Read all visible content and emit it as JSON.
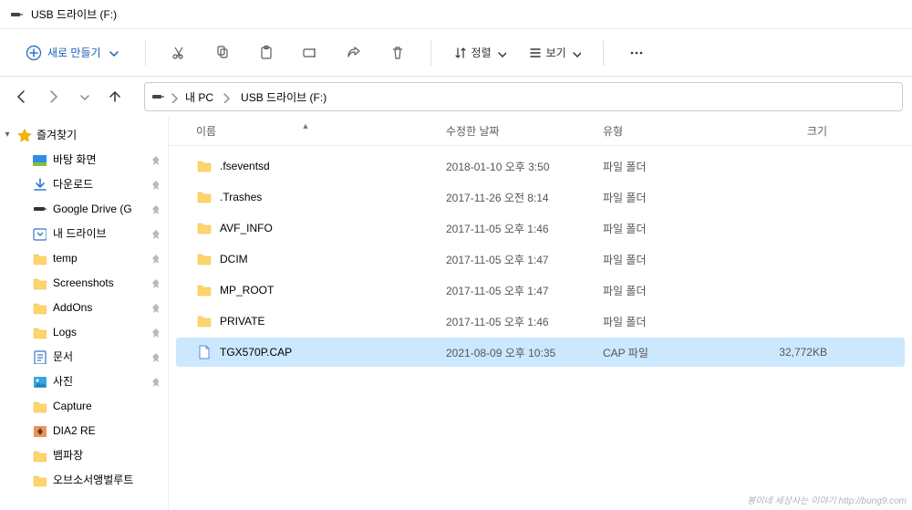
{
  "window": {
    "title": "USB 드라이브 (F:)"
  },
  "toolbar": {
    "new_label": "새로 만들기",
    "sort_label": "정렬",
    "view_label": "보기"
  },
  "breadcrumb": [
    {
      "label": "내 PC"
    },
    {
      "label": "USB 드라이브 (F:)"
    }
  ],
  "sidebar": {
    "favorites_label": "즐겨찾기",
    "items": [
      {
        "label": "바탕 화면",
        "icon": "desktop",
        "pinned": true
      },
      {
        "label": "다운로드",
        "icon": "download",
        "pinned": true
      },
      {
        "label": "Google Drive (G",
        "icon": "gdrive",
        "pinned": true
      },
      {
        "label": "내 드라이브",
        "icon": "mydrive",
        "pinned": true
      },
      {
        "label": "temp",
        "icon": "folder",
        "pinned": true
      },
      {
        "label": "Screenshots",
        "icon": "folder",
        "pinned": true
      },
      {
        "label": "AddOns",
        "icon": "folder",
        "pinned": true
      },
      {
        "label": "Logs",
        "icon": "folder",
        "pinned": true
      },
      {
        "label": "문서",
        "icon": "documents",
        "pinned": true
      },
      {
        "label": "사진",
        "icon": "pictures",
        "pinned": true
      },
      {
        "label": "Capture",
        "icon": "folder"
      },
      {
        "label": "DIA2 RE",
        "icon": "dia2"
      },
      {
        "label": "뱀파장",
        "icon": "folder"
      },
      {
        "label": "오브소서앵벌루트",
        "icon": "folder"
      }
    ]
  },
  "columns": {
    "name": "이름",
    "modified": "수정한 날짜",
    "type": "유형",
    "size": "크기"
  },
  "files": [
    {
      "name": ".fseventsd",
      "modified": "2018-01-10 오후 3:50",
      "type": "파일 폴더",
      "size": "",
      "kind": "folder"
    },
    {
      "name": ".Trashes",
      "modified": "2017-11-26 오전 8:14",
      "type": "파일 폴더",
      "size": "",
      "kind": "folder"
    },
    {
      "name": "AVF_INFO",
      "modified": "2017-11-05 오후 1:46",
      "type": "파일 폴더",
      "size": "",
      "kind": "folder"
    },
    {
      "name": "DCIM",
      "modified": "2017-11-05 오후 1:47",
      "type": "파일 폴더",
      "size": "",
      "kind": "folder"
    },
    {
      "name": "MP_ROOT",
      "modified": "2017-11-05 오후 1:47",
      "type": "파일 폴더",
      "size": "",
      "kind": "folder"
    },
    {
      "name": "PRIVATE",
      "modified": "2017-11-05 오후 1:46",
      "type": "파일 폴더",
      "size": "",
      "kind": "folder"
    },
    {
      "name": "TGX570P.CAP",
      "modified": "2021-08-09 오후 10:35",
      "type": "CAP 파일",
      "size": "32,772KB",
      "kind": "file",
      "selected": true
    }
  ],
  "watermark": "봉이네 세상사는 이야기  http://bung9.com"
}
